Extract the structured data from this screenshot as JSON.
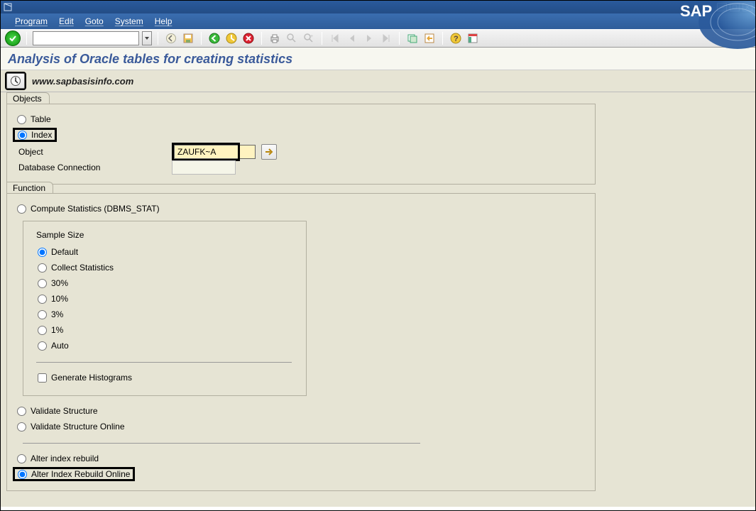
{
  "menu": {
    "program": "Program",
    "edit": "Edit",
    "goto": "Goto",
    "system": "System",
    "help": "Help"
  },
  "page_title": "Analysis of Oracle tables for creating statistics",
  "app_link": "www.sapbasisinfo.com",
  "objects": {
    "group_label": "Objects",
    "table": "Table",
    "index": "Index",
    "object_label": "Object",
    "object_value": "ZAUFK~A",
    "db_conn_label": "Database Connection"
  },
  "function": {
    "group_label": "Function",
    "compute": "Compute Statistics (DBMS_STAT)",
    "sample_size": "Sample Size",
    "default": "Default",
    "collect": "Collect Statistics",
    "p30": "30%",
    "p10": "10%",
    "p3": "3%",
    "p1": "1%",
    "auto": "Auto",
    "gen_hist": "Generate Histograms",
    "validate": "Validate Structure",
    "validate_online": "Validate Structure Online",
    "alter_rebuild": "Alter index rebuild",
    "alter_rebuild_online": "Alter Index Rebuild Online"
  }
}
